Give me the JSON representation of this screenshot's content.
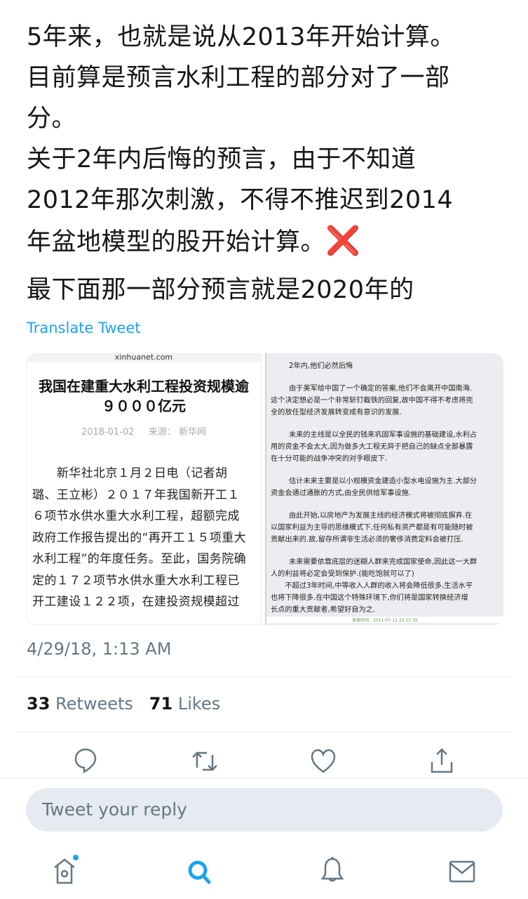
{
  "tweet": {
    "lines": [
      "5年来，也就是说从2013年开始计算。",
      "目前算是预言水利工程的部分对了一部",
      "分。",
      "关于2年内后悔的预言，由于不知道",
      "2012年那次刺激，不得不推迟到2014",
      "年盆地模型的股开始计算。",
      "最下面那一部分预言就是2020年的"
    ],
    "cross_mark": "❌",
    "translate": "Translate Tweet",
    "timestamp": "4/29/18, 1:13 AM",
    "retweets_count": "33",
    "retweets_label": "Retweets",
    "likes_count": "71",
    "likes_label": "Likes"
  },
  "media_left": {
    "site": "xinhuanet.com",
    "headline_1": "我国在建重大水利工程投资规模逾",
    "headline_2": "９０００亿元",
    "date": "2018-01-02",
    "source": "来源：  新华网",
    "body": [
      "　　新华社北京１月２日电（记者胡",
      "璐、王立彬）２０１７年我国新开工１",
      "６项节水供水重大水利工程，超额完成",
      "政府工作报告提出的“再开工１５项重大",
      "水利工程”的年度任务。至此，国务院确",
      "定的１７２项节水供水重大水利工程已",
      "开工建设１２２项，在建投资规模超过"
    ]
  },
  "media_right": {
    "title": "2年内,他们必然后悔",
    "paragraphs": [
      [
        "由于美军给中国了一个确定的答案,他们不会离开中国南海.",
        "这个决定想必是一个非常斩钉截铁的回复,故中国不得不考虑将完",
        "全的放任型经济发展转变成有意识的发展."
      ],
      [
        "未来的主线是以全民的钱来巩固军事设施的基础建设,水利占",
        "用的资金不会太大,因为做多大工程无异于把自己的缺点全部暴露",
        "在十分可能的战争冲突的对手眼皮下."
      ],
      [
        "估计未来主要是以小规模资金建造小型水电设施为主.大部分",
        "资金会通过通胀的方式,由全民供给军事设施."
      ],
      [
        "由此开始,以房地产为发展主线的经济模式将被彻底摒弃.在",
        "以国家利益为主导的思维模式下,任何私有资产都是有可能随时被",
        "贡献出来的.故,留存所谓非生活必须的奢侈消费定料会被打压."
      ],
      [
        "未来需要依靠底层的迷糊人群来完成国家使命,因此这一大群",
        "人的利益将必定会受到保护.(能吃饱就可以了)",
        "　　不超过3年时间,中等收入人群的收入将会降低很多,生活水平",
        "也将下降很多.在中国这个特殊环境下,你们将是国家转换经济增",
        "长点的重大贡献者,希望好自为之."
      ]
    ],
    "stamp": "发表时间：2011-07-11 22:15:35"
  },
  "reply": {
    "placeholder": "Tweet your reply"
  },
  "icons": {
    "actions": [
      "reply-icon",
      "retweet-icon",
      "like-icon",
      "share-icon"
    ],
    "tabs": [
      "home-icon",
      "search-icon",
      "notifications-icon",
      "messages-icon"
    ]
  },
  "colors": {
    "accent": "#1da1f2",
    "muted": "#657786",
    "icon": "#657786",
    "cross": "#e0202a"
  }
}
